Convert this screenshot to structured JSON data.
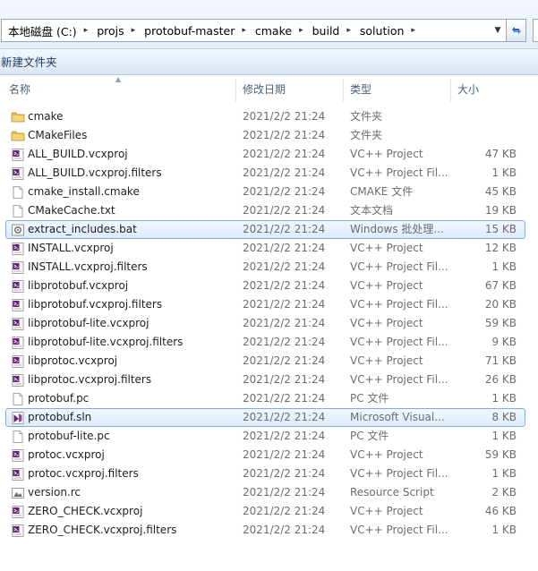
{
  "address_bar": {
    "crumbs": [
      "本地磁盘 (C:)",
      "projs",
      "protobuf-master",
      "cmake",
      "build",
      "solution"
    ]
  },
  "command_bar": {
    "new_folder_label": "新建文件夹"
  },
  "columns": {
    "name": "名称",
    "date": "修改日期",
    "type": "类型",
    "size": "大小"
  },
  "files": [
    {
      "name": "cmake",
      "date": "2021/2/2 21:24",
      "type": "文件夹",
      "size": "",
      "icon": "folder-icon"
    },
    {
      "name": "CMakeFiles",
      "date": "2021/2/2 21:24",
      "type": "文件夹",
      "size": "",
      "icon": "folder-icon"
    },
    {
      "name": "ALL_BUILD.vcxproj",
      "date": "2021/2/2 21:24",
      "type": "VC++ Project",
      "size": "47 KB",
      "icon": "vcxproj-icon"
    },
    {
      "name": "ALL_BUILD.vcxproj.filters",
      "date": "2021/2/2 21:24",
      "type": "VC++ Project Fil...",
      "size": "1 KB",
      "icon": "vcxproj-icon"
    },
    {
      "name": "cmake_install.cmake",
      "date": "2021/2/2 21:24",
      "type": "CMAKE 文件",
      "size": "45 KB",
      "icon": "file-icon"
    },
    {
      "name": "CMakeCache.txt",
      "date": "2021/2/2 21:24",
      "type": "文本文档",
      "size": "19 KB",
      "icon": "file-icon"
    },
    {
      "name": "extract_includes.bat",
      "date": "2021/2/2 21:24",
      "type": "Windows 批处理...",
      "size": "15 KB",
      "icon": "bat-icon",
      "selected": true
    },
    {
      "name": "INSTALL.vcxproj",
      "date": "2021/2/2 21:24",
      "type": "VC++ Project",
      "size": "12 KB",
      "icon": "vcxproj-icon"
    },
    {
      "name": "INSTALL.vcxproj.filters",
      "date": "2021/2/2 21:24",
      "type": "VC++ Project Fil...",
      "size": "1 KB",
      "icon": "vcxproj-icon"
    },
    {
      "name": "libprotobuf.vcxproj",
      "date": "2021/2/2 21:24",
      "type": "VC++ Project",
      "size": "67 KB",
      "icon": "vcxproj-icon"
    },
    {
      "name": "libprotobuf.vcxproj.filters",
      "date": "2021/2/2 21:24",
      "type": "VC++ Project Fil...",
      "size": "20 KB",
      "icon": "vcxproj-icon"
    },
    {
      "name": "libprotobuf-lite.vcxproj",
      "date": "2021/2/2 21:24",
      "type": "VC++ Project",
      "size": "59 KB",
      "icon": "vcxproj-icon"
    },
    {
      "name": "libprotobuf-lite.vcxproj.filters",
      "date": "2021/2/2 21:24",
      "type": "VC++ Project Fil...",
      "size": "9 KB",
      "icon": "vcxproj-icon"
    },
    {
      "name": "libprotoc.vcxproj",
      "date": "2021/2/2 21:24",
      "type": "VC++ Project",
      "size": "71 KB",
      "icon": "vcxproj-icon"
    },
    {
      "name": "libprotoc.vcxproj.filters",
      "date": "2021/2/2 21:24",
      "type": "VC++ Project Fil...",
      "size": "26 KB",
      "icon": "vcxproj-icon"
    },
    {
      "name": "protobuf.pc",
      "date": "2021/2/2 21:24",
      "type": "PC 文件",
      "size": "1 KB",
      "icon": "file-icon"
    },
    {
      "name": "protobuf.sln",
      "date": "2021/2/2 21:24",
      "type": "Microsoft Visual...",
      "size": "8 KB",
      "icon": "sln-icon",
      "selected": true
    },
    {
      "name": "protobuf-lite.pc",
      "date": "2021/2/2 21:24",
      "type": "PC 文件",
      "size": "1 KB",
      "icon": "file-icon"
    },
    {
      "name": "protoc.vcxproj",
      "date": "2021/2/2 21:24",
      "type": "VC++ Project",
      "size": "59 KB",
      "icon": "vcxproj-icon"
    },
    {
      "name": "protoc.vcxproj.filters",
      "date": "2021/2/2 21:24",
      "type": "VC++ Project Fil...",
      "size": "1 KB",
      "icon": "vcxproj-icon"
    },
    {
      "name": "version.rc",
      "date": "2021/2/2 21:24",
      "type": "Resource Script",
      "size": "2 KB",
      "icon": "image-file-icon"
    },
    {
      "name": "ZERO_CHECK.vcxproj",
      "date": "2021/2/2 21:24",
      "type": "VC++ Project",
      "size": "46 KB",
      "icon": "vcxproj-icon"
    },
    {
      "name": "ZERO_CHECK.vcxproj.filters",
      "date": "2021/2/2 21:24",
      "type": "VC++ Project Fil...",
      "size": "1 KB",
      "icon": "vcxproj-icon"
    }
  ],
  "colors": {
    "selection_border": "#84acdd",
    "selection_fill": "#dcebfc",
    "header_text": "#4c607a",
    "secondary_text": "#6d6d6d",
    "folder": "#e8b84a",
    "vcxproj": "#68217a"
  }
}
